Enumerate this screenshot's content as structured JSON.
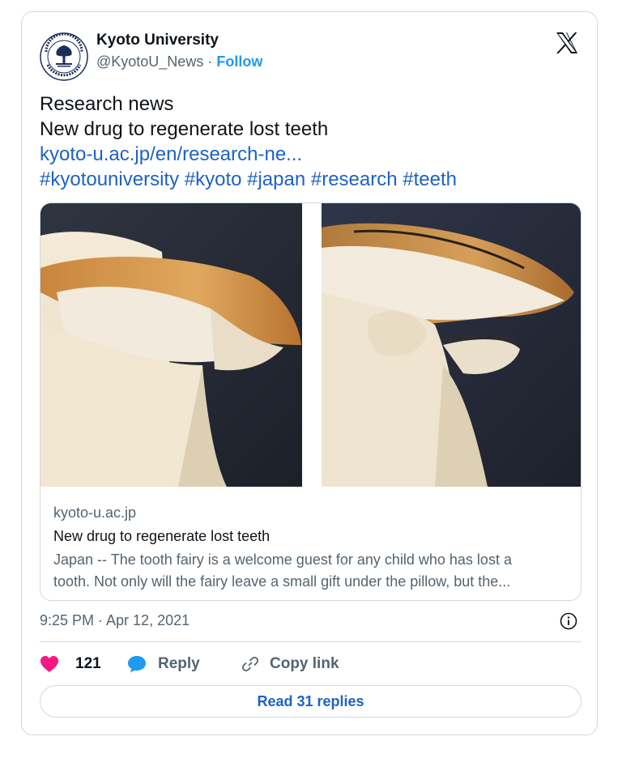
{
  "author": {
    "name": "Kyoto University",
    "handle": "@KyotoU_News",
    "separator": "·",
    "follow_label": "Follow",
    "avatar_seal_text_top": "KYOTO UNIVERSITY",
    "avatar_seal_text_bottom": "FOUNDED 1897"
  },
  "tweet": {
    "line1": "Research news",
    "line2": "New drug to regenerate lost teeth",
    "link": "kyoto-u.ac.jp/en/research-ne...",
    "hashtags": "#kyotouniversity #kyoto #japan #research #teeth"
  },
  "preview": {
    "domain": "kyoto-u.ac.jp",
    "title": "New drug to regenerate lost teeth",
    "description_line1": "Japan -- The tooth fairy is a welcome guest for any child who has lost a",
    "description_line2": "tooth. Not only will the fairy leave a small gift under the pillow, but the..."
  },
  "timestamp": "9:25 PM · Apr 12, 2021",
  "actions": {
    "likes": "121",
    "reply_label": "Reply",
    "copy_label": "Copy link"
  },
  "read_replies_label": "Read 31 replies",
  "icons": [
    "x-logo-icon",
    "heart-icon",
    "reply-bubble-icon",
    "link-icon",
    "info-icon"
  ],
  "colors": {
    "link": "#1d62c4",
    "follow": "#1d9bf0",
    "heart": "#f91880",
    "reply": "#1d9bf0",
    "border": "#cfd9de",
    "muted": "#536471"
  }
}
